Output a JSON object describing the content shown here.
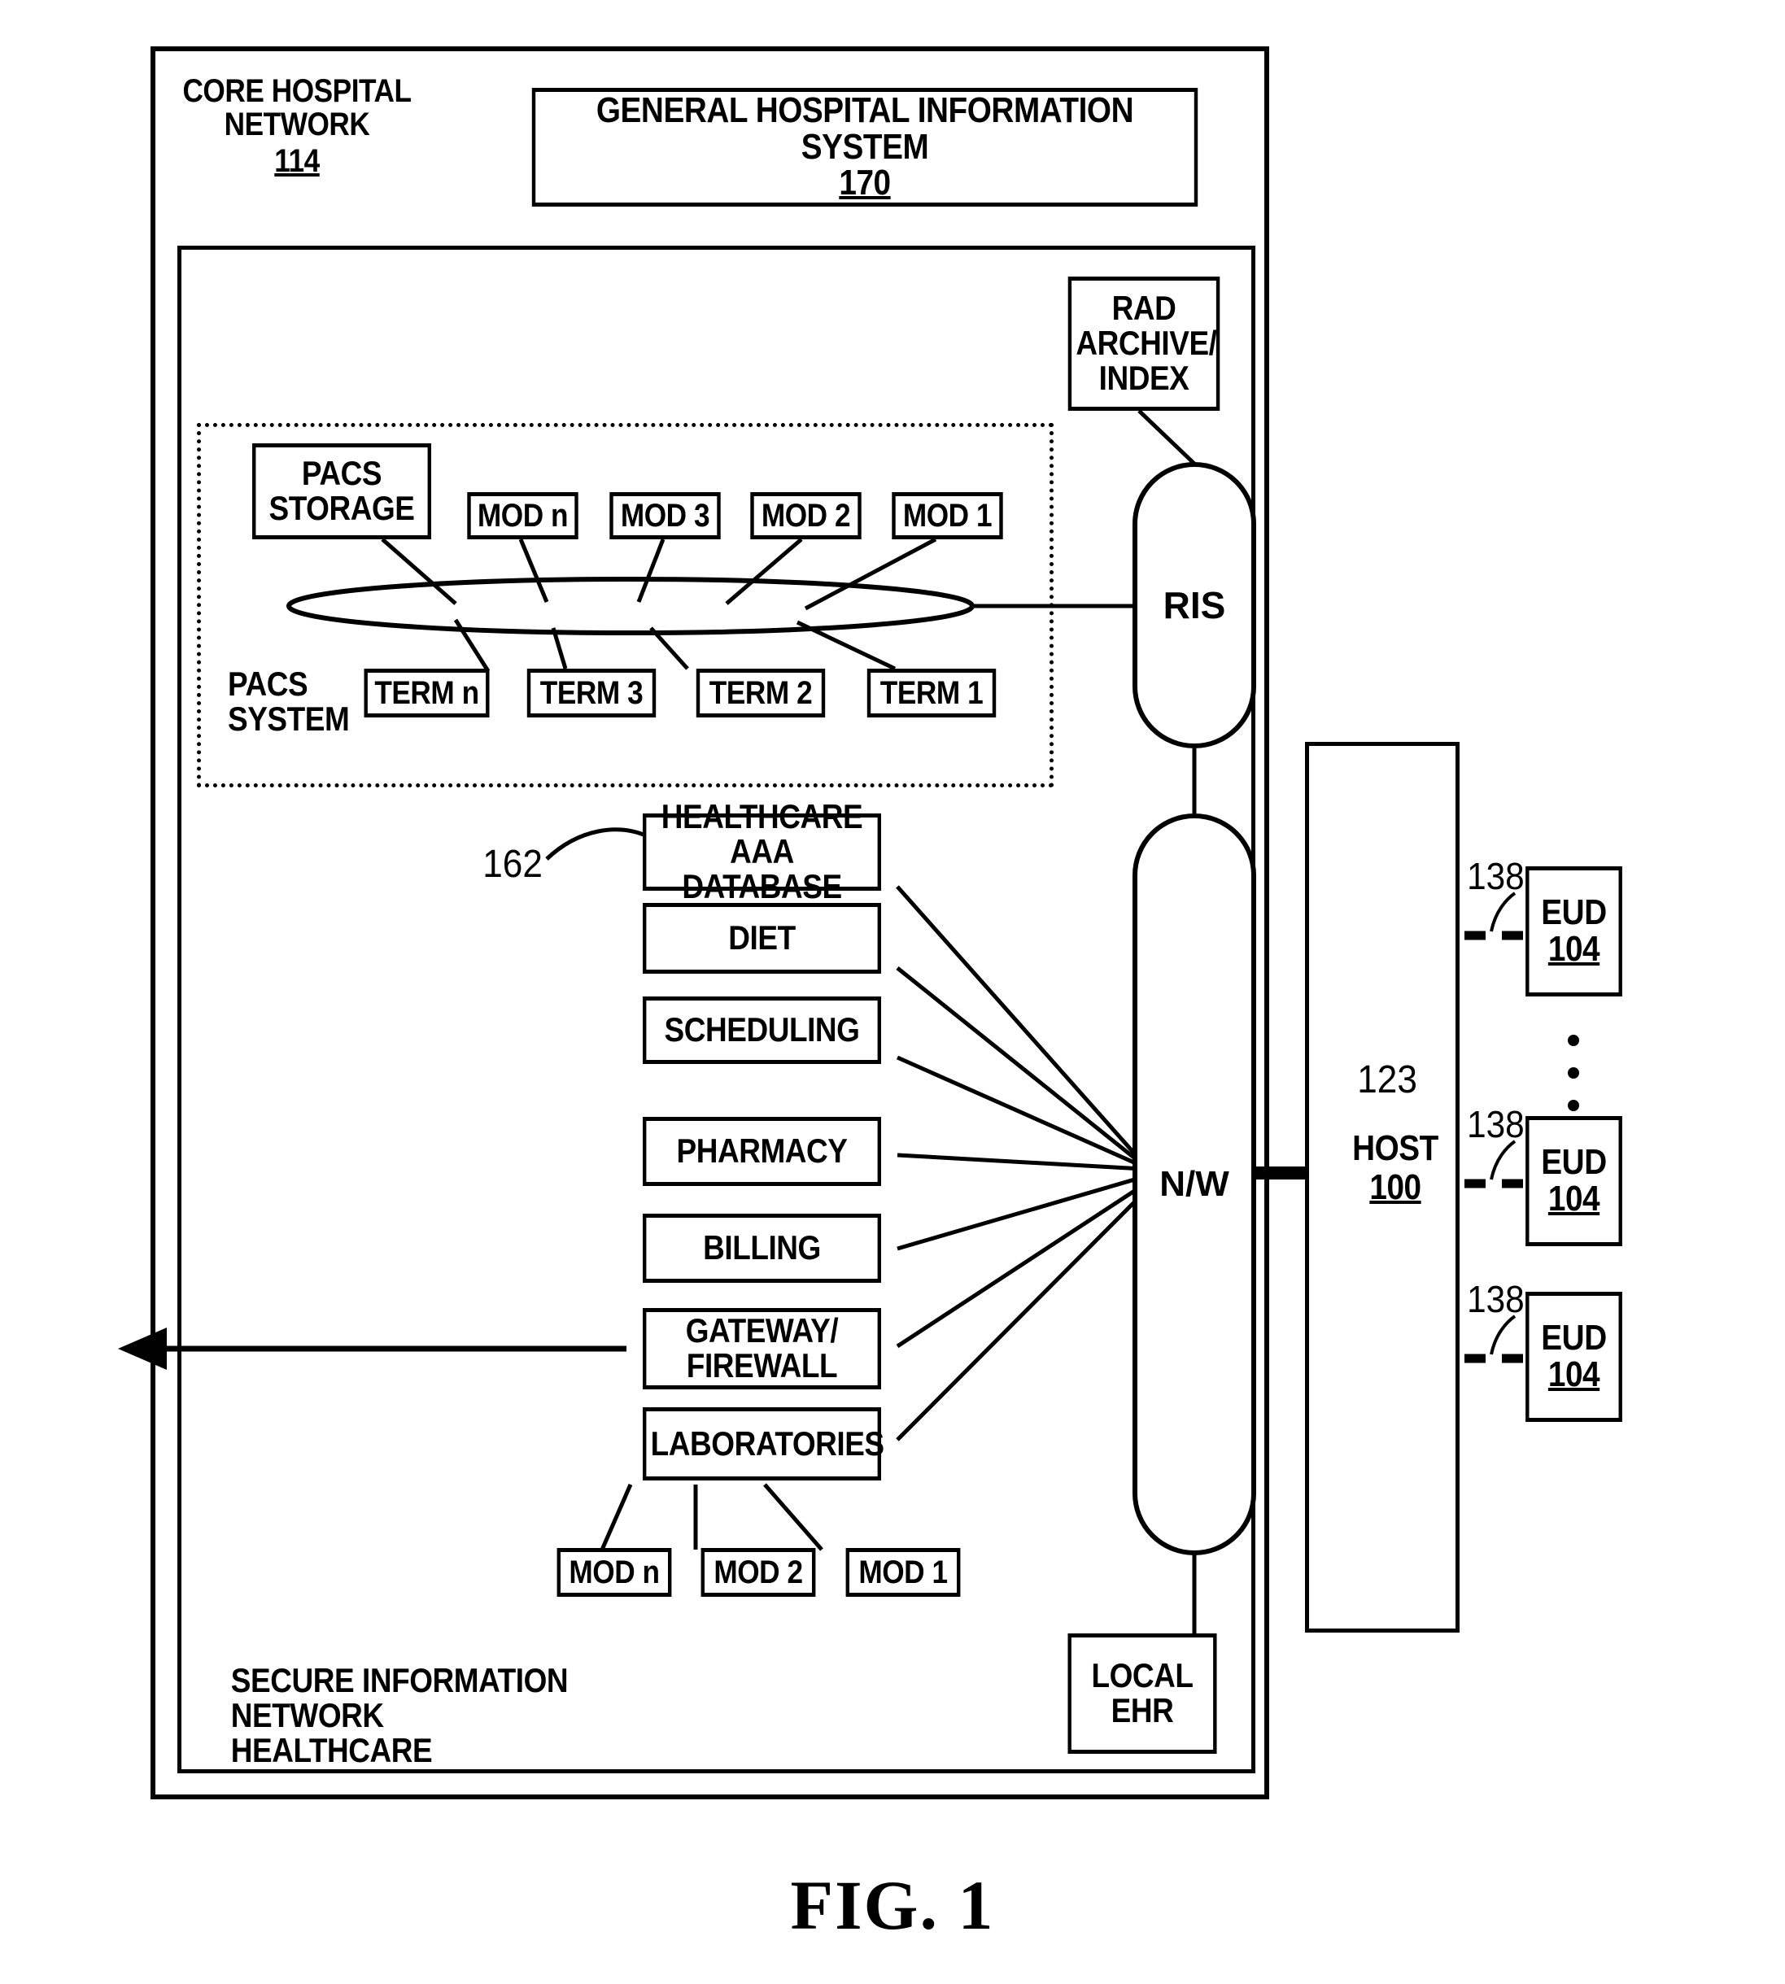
{
  "figure": {
    "caption": "FIG. 1"
  },
  "core_network": {
    "label": "CORE HOSPITAL\nNETWORK",
    "ref": "114"
  },
  "ghis": {
    "title": "GENERAL HOSPITAL INFORMATION SYSTEM",
    "ref": "170"
  },
  "secure_network": {
    "label": "SECURE INFORMATION\nNETWORK HEALTHCARE"
  },
  "pacs": {
    "system_label": "PACS\nSYSTEM",
    "storage_label": "PACS\nSTORAGE",
    "modalities": [
      {
        "label": "MOD n"
      },
      {
        "label": "MOD 3"
      },
      {
        "label": "MOD 2"
      },
      {
        "label": "MOD 1"
      }
    ],
    "terminals": [
      {
        "label": "TERM n"
      },
      {
        "label": "TERM 3"
      },
      {
        "label": "TERM 2"
      },
      {
        "label": "TERM 1"
      }
    ]
  },
  "rad_archive": {
    "label": "RAD\nARCHIVE/\nINDEX"
  },
  "ris": {
    "label": "RIS"
  },
  "network": {
    "label": "N/W"
  },
  "local_ehr": {
    "label": "LOCAL\nEHR"
  },
  "services": [
    {
      "label": "HEALTHCARE\nAAA DATABASE",
      "ref": "162"
    },
    {
      "label": "DIET"
    },
    {
      "label": "SCHEDULING"
    },
    {
      "label": "PHARMACY"
    },
    {
      "label": "BILLING"
    },
    {
      "label": "GATEWAY/\nFIREWALL"
    },
    {
      "label": "LABORATORIES"
    }
  ],
  "lab_modalities": [
    {
      "label": "MOD n"
    },
    {
      "label": "MOD 2"
    },
    {
      "label": "MOD 1"
    }
  ],
  "host": {
    "label": "HOST",
    "ref": "100",
    "link_ref": "123"
  },
  "euds": [
    {
      "label": "EUD",
      "ref": "104",
      "link_ref": "138"
    },
    {
      "label": "EUD",
      "ref": "104",
      "link_ref": "138"
    },
    {
      "label": "EUD",
      "ref": "104",
      "link_ref": "138"
    }
  ],
  "colors": {
    "ink": "#000000",
    "paper": "#ffffff"
  }
}
